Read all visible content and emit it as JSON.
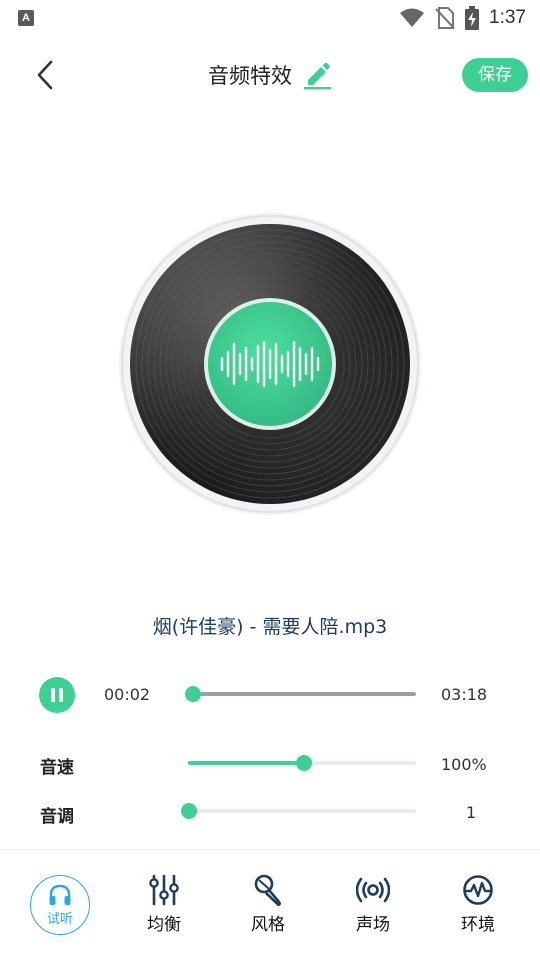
{
  "status_bar": {
    "app_icon_letter": "A",
    "time": "1:37",
    "icons": [
      "wifi-icon",
      "no-sim-icon",
      "battery-charging-icon"
    ]
  },
  "header": {
    "title": "音频特效",
    "save_label": "保存",
    "icons": [
      "back-arrow-icon",
      "edit-pencil-icon"
    ]
  },
  "player": {
    "song_title": "烟(许佳豪) - 需要人陪.mp3",
    "current_time": "00:02",
    "total_time": "03:18",
    "progress": 0.01,
    "state": "playing"
  },
  "controls": {
    "speed": {
      "label": "音速",
      "value": "100%",
      "level": 0.5
    },
    "pitch": {
      "label": "音调",
      "value": "1",
      "level": 0.0
    }
  },
  "bottom_nav": {
    "items": [
      {
        "label": "试听",
        "icon": "headphones-icon",
        "active": true
      },
      {
        "label": "均衡",
        "icon": "equalizer-sliders-icon",
        "active": false
      },
      {
        "label": "风格",
        "icon": "microphone-icon",
        "active": false
      },
      {
        "label": "声场",
        "icon": "broadcast-icon",
        "active": false
      },
      {
        "label": "环境",
        "icon": "waveform-circle-icon",
        "active": false
      }
    ]
  },
  "colors": {
    "accent": "#3ecf95",
    "active_nav": "#2ea7e0",
    "title_text": "#1d3c5e",
    "track_light": "#e3f1ee",
    "track_gray": "#9aa1a6"
  }
}
